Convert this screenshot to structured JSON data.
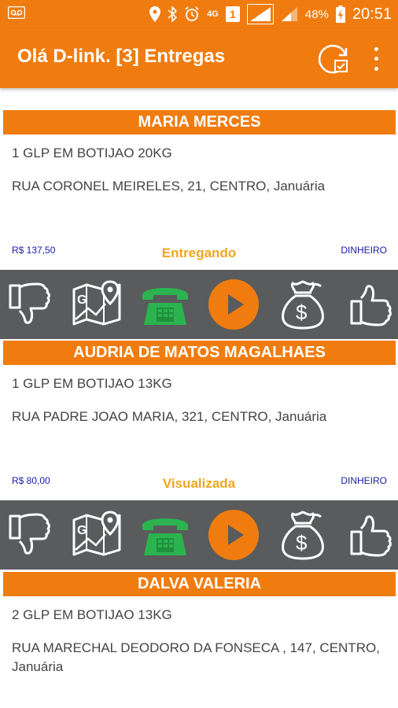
{
  "status_bar": {
    "network": "4G",
    "sim": "1",
    "battery": "48%",
    "time": "20:51"
  },
  "app_bar": {
    "title": "Olá D-link. [3] Entregas"
  },
  "colors": {
    "primary": "#f07c0f",
    "action_bar": "#595b5c",
    "phone_green": "#2bb34f",
    "status_text": "#f0a61e",
    "price_text": "#1a1aa8"
  },
  "deliveries": [
    {
      "name": "MARIA MERCES",
      "product": "1 GLP EM BOTIJAO 20KG",
      "address": "RUA CORONEL MEIRELES, 21, CENTRO, Januária",
      "price": "R$ 137,50",
      "status": "Entregando",
      "payment": "DINHEIRO"
    },
    {
      "name": "AUDRIA DE MATOS MAGALHAES",
      "product": "1 GLP EM BOTIJAO 13KG",
      "address": "RUA PADRE JOAO MARIA, 321, CENTRO, Januária",
      "price": "R$ 80,00",
      "status": "Visualizada",
      "payment": "DINHEIRO"
    },
    {
      "name": "DALVA VALERIA",
      "product": "2 GLP EM BOTIJAO 13KG",
      "address": "RUA MARECHAL DEODORO DA FONSECA , 147, CENTRO, Januária"
    }
  ],
  "action_icons": [
    "thumbs-down-icon",
    "map-icon",
    "phone-icon",
    "play-icon",
    "money-bag-icon",
    "thumbs-up-icon"
  ]
}
